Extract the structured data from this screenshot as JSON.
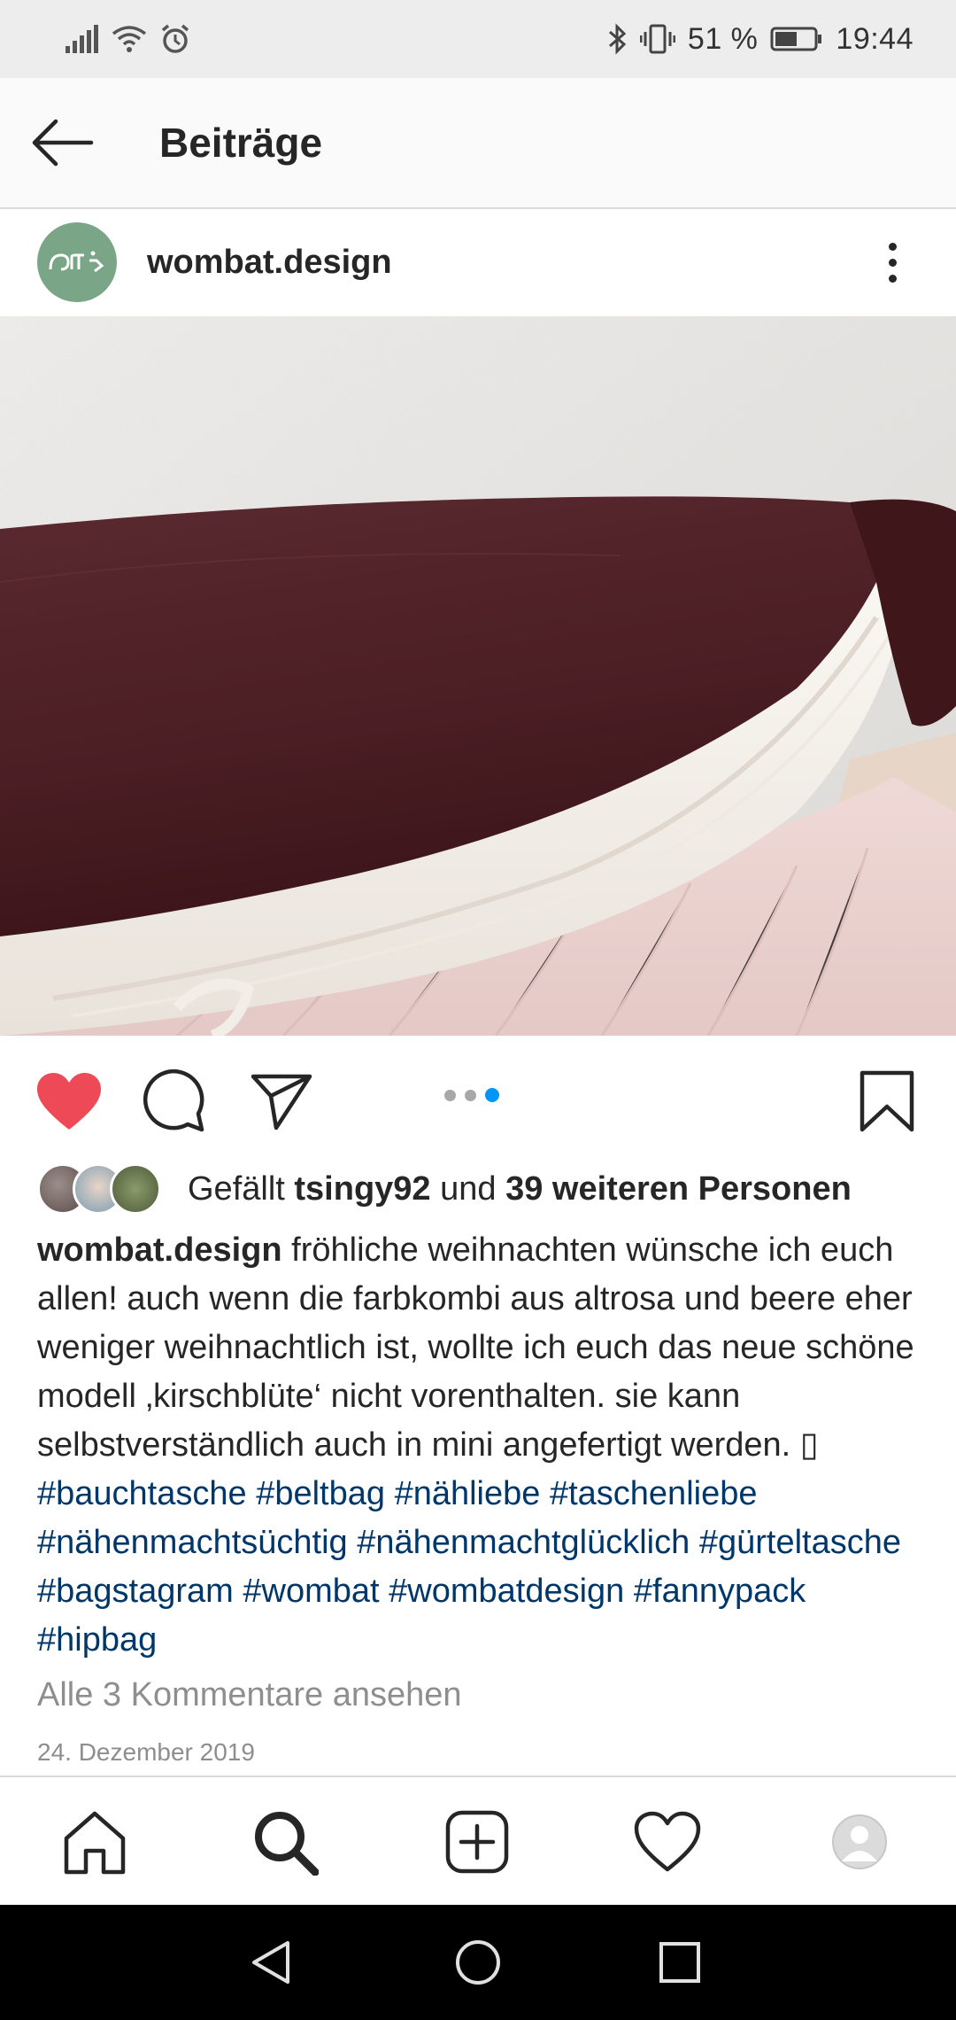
{
  "status_bar": {
    "battery_percent": "51 %",
    "time": "19:44",
    "icons": [
      "signal-icon",
      "wifi-icon",
      "alarm-icon",
      "bluetooth-icon",
      "vibrate-icon",
      "battery-icon"
    ]
  },
  "header": {
    "title": "Beiträge"
  },
  "post": {
    "username": "wombat.design",
    "carousel": {
      "count": 3,
      "active_index": 2
    },
    "likes": {
      "prefix": "Gefällt ",
      "user": "tsingy92",
      "middle": " und ",
      "others": "39 weiteren Personen"
    },
    "caption": {
      "username": "wombat.design",
      "text": "fröhliche weihnachten wünsche ich euch allen! auch wenn die farbkombi aus altrosa und beere eher weniger weihnachtlich ist, wollte ich euch das neue schöne modell ‚kirschblüte‘ nicht vorenthalten. sie kann selbstverständlich auch in mini angefertigt werden. ▯ ",
      "hashtags": [
        "#bauchtasche",
        "#beltbag",
        "#nähliebe",
        "#taschenliebe",
        "#nähenmachtsüchtig",
        "#nähenmachtglücklich",
        "#gürteltasche",
        "#bagstagram",
        "#wombat",
        "#wombatdesign",
        "#fannypack",
        "#hipbag"
      ]
    },
    "comments_link": "Alle 3 Kommentare ansehen",
    "date": "24. Dezember 2019"
  },
  "colors": {
    "like_red": "#ed4956",
    "link_blue": "#00376b",
    "dot_active": "#0095f6",
    "avatar_green": "#7aa586",
    "bag_burgundy": "#4a1e23"
  },
  "bottom_nav": [
    "home-icon",
    "search-icon",
    "new-post-icon",
    "activity-icon",
    "profile-icon"
  ],
  "system_nav": [
    "back-triangle-icon",
    "home-circle-icon",
    "recents-square-icon"
  ]
}
